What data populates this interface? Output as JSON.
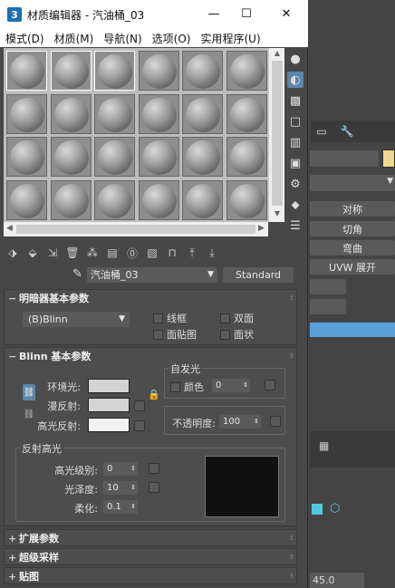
{
  "window": {
    "title": "材质编辑器 - 汽油桶_03",
    "app_icon": "3",
    "minimize": "—",
    "maximize": "☐",
    "close": "✕"
  },
  "menu": [
    "模式(D)",
    "材质(M)",
    "导航(N)",
    "选项(O)",
    "实用程序(U)"
  ],
  "material": {
    "name": "汽油桶_03",
    "type": "Standard"
  },
  "shader_rollout": {
    "title": "明暗器基本参数",
    "shader": "(B)Blinn",
    "wire": "线框",
    "two_sided": "双面",
    "face_map": "面贴图",
    "faceted": "面状"
  },
  "blinn_rollout": {
    "title": "Blinn 基本参数",
    "ambient": "环境光:",
    "diffuse": "漫反射:",
    "specular": "高光反射:",
    "self_illum_title": "自发光",
    "color": "颜色",
    "color_value": "0",
    "opacity": "不透明度:",
    "opacity_value": "100",
    "spec_title": "反射高光",
    "spec_level": "高光级别:",
    "spec_level_value": "0",
    "glossiness": "光泽度:",
    "glossiness_value": "10",
    "soften": "柔化:",
    "soften_value": "0.1"
  },
  "collapsed_rollouts": [
    "扩展参数",
    "超级采样",
    "贴图"
  ],
  "background_panel": {
    "buttons": [
      "对称",
      "切角",
      "弯曲",
      "UVW 展开"
    ],
    "num_value": "45.0"
  },
  "colors": {
    "ambient": "#d4d4d4",
    "diffuse": "#d4d4d4",
    "specular": "#f2f2f2",
    "selected_tool": "#5c86a8"
  }
}
